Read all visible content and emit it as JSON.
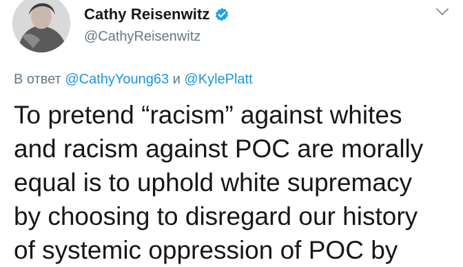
{
  "author": {
    "display_name": "Cathy Reisenwitz",
    "handle": "@CathyReisenwitz",
    "verified": true
  },
  "icons": {
    "verified": "verified-badge-icon",
    "menu": "chevron-down-icon"
  },
  "colors": {
    "link": "#1b95e0",
    "secondary_text": "#657786",
    "primary_text": "#14171a",
    "verified": "#1da1f2"
  },
  "reply": {
    "prefix": "В ответ",
    "mention_1": "@CathyYoung63",
    "conjunction": "и",
    "mention_2": "@KylePlatt"
  },
  "tweet": {
    "lines": [
      "To pretend “racism” against whites",
      "and racism against POC are morally",
      "equal is to uphold white supremacy",
      "by choosing to disregard our history",
      "of systemic oppression of POC by"
    ]
  }
}
